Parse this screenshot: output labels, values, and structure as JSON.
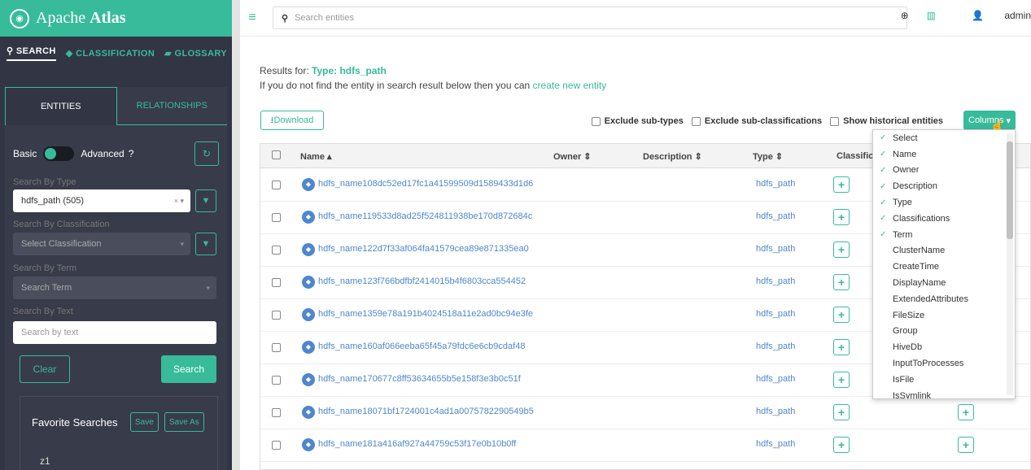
{
  "brand": {
    "name_prefix": "Apache",
    "name_suffix": "Atlas"
  },
  "main_tabs": [
    {
      "icon": "search-icon",
      "label": "SEARCH",
      "active": true
    },
    {
      "icon": "tag-icon",
      "label": "CLASSIFICATION",
      "active": false
    },
    {
      "icon": "folder-icon",
      "label": "GLOSSARY",
      "active": false
    }
  ],
  "sub_tabs": [
    {
      "label": "ENTITIES",
      "active": true
    },
    {
      "label": "RELATIONSHIPS",
      "active": false
    }
  ],
  "search_mode": {
    "basic": "Basic",
    "advanced": "Advanced",
    "selected": "Basic"
  },
  "filters": {
    "by_type_label": "Search By Type",
    "by_type_value": "hdfs_path (505)",
    "by_classification_label": "Search By Classification",
    "by_classification_placeholder": "Select Classification",
    "by_term_label": "Search By Term",
    "by_term_placeholder": "Search Term",
    "by_text_label": "Search By Text",
    "by_text_placeholder": "Search by text"
  },
  "actions": {
    "clear": "Clear",
    "search": "Search"
  },
  "favorites": {
    "title": "Favorite Searches",
    "save": "Save",
    "save_as": "Save As",
    "items": [
      "z1"
    ]
  },
  "topbar": {
    "search_placeholder": "Search entities",
    "user": "admin"
  },
  "results": {
    "prefix": "Results for:",
    "type_label": "Type: hdfs_path",
    "hint_text": "If you do not find the entity in search result below then you can",
    "hint_link": "create new entity"
  },
  "toolbar": {
    "download": "Download",
    "exclude_subtypes": "Exclude sub-types",
    "exclude_subclass": "Exclude sub-classifications",
    "show_historical": "Show historical entities",
    "columns": "Columns"
  },
  "table": {
    "headers": {
      "name": "Name",
      "owner": "Owner",
      "description": "Description",
      "type": "Type",
      "classifications": "Classific"
    },
    "rows": [
      {
        "name": "hdfs_name108dc52ed17fc1a41599509d1589433d1d6",
        "type": "hdfs_path"
      },
      {
        "name": "hdfs_name119533d8ad25f524811938be170d872684c",
        "type": "hdfs_path"
      },
      {
        "name": "hdfs_name122d7f33af064fa41579cea89e871335ea0",
        "type": "hdfs_path"
      },
      {
        "name": "hdfs_name123f766bdfbf2414015b4f6803cca554452",
        "type": "hdfs_path"
      },
      {
        "name": "hdfs_name1359e78a191b4024518a11e2ad0bc94e3fe",
        "type": "hdfs_path"
      },
      {
        "name": "hdfs_name160af066eeba65f45a79fdc6e6cb9cdaf48",
        "type": "hdfs_path"
      },
      {
        "name": "hdfs_name170677c8ff53634655b5e158f3e3b0c51f",
        "type": "hdfs_path"
      },
      {
        "name": "hdfs_name18071bf1724001c4ad1a0075782290549b5",
        "type": "hdfs_path"
      },
      {
        "name": "hdfs_name181a416af927a44759c53f17e0b10b0ff",
        "type": "hdfs_path"
      }
    ]
  },
  "columns_menu": [
    {
      "label": "Select",
      "checked": true
    },
    {
      "label": "Name",
      "checked": true
    },
    {
      "label": "Owner",
      "checked": true
    },
    {
      "label": "Description",
      "checked": true
    },
    {
      "label": "Type",
      "checked": true
    },
    {
      "label": "Classifications",
      "checked": true
    },
    {
      "label": "Term",
      "checked": true
    },
    {
      "label": "ClusterName",
      "checked": false
    },
    {
      "label": "CreateTime",
      "checked": false
    },
    {
      "label": "DisplayName",
      "checked": false
    },
    {
      "label": "ExtendedAttributes",
      "checked": false
    },
    {
      "label": "FileSize",
      "checked": false
    },
    {
      "label": "Group",
      "checked": false
    },
    {
      "label": "HiveDb",
      "checked": false
    },
    {
      "label": "InputToProcesses",
      "checked": false
    },
    {
      "label": "IsFile",
      "checked": false
    },
    {
      "label": "IsSymlink",
      "checked": false
    }
  ],
  "colors": {
    "accent": "#37bb9b",
    "sidebar": "#323544",
    "link": "#4f87cc"
  }
}
